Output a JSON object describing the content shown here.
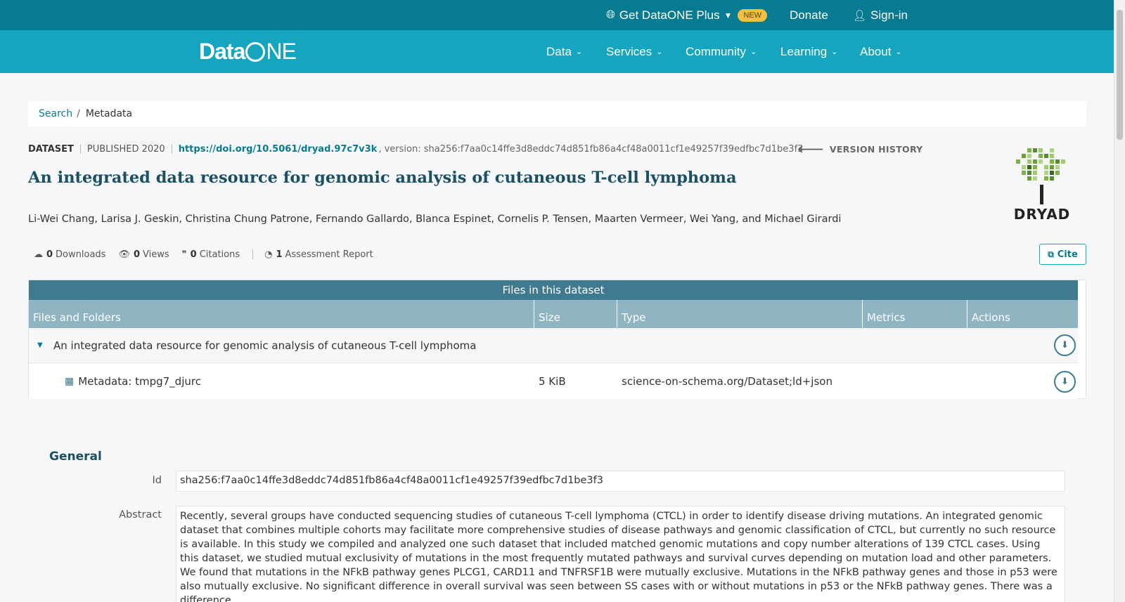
{
  "utility": {
    "plus_label": "Get DataONE Plus",
    "new_badge": "NEW",
    "donate_label": "Donate",
    "signin_label": "Sign-in"
  },
  "nav": {
    "logo_data": "Data",
    "logo_ne": "NE",
    "items": [
      {
        "label": "Data"
      },
      {
        "label": "Services"
      },
      {
        "label": "Community"
      },
      {
        "label": "Learning"
      },
      {
        "label": "About"
      }
    ]
  },
  "breadcrumb": {
    "search": "Search",
    "separator": "/",
    "current": "Metadata"
  },
  "dataset": {
    "type_label": "DATASET",
    "published": "PUBLISHED 2020",
    "doi": "https://doi.org/10.5061/dryad.97c7v3k",
    "version": ", version: sha256:f7aa0c14ffe3d8eddc74d851fb86a4cf48a0011cf1e49257f39edfbc7d1be3f3",
    "version_history": "VERSION HISTORY",
    "title": "An integrated data resource for genomic analysis of cutaneous T-cell lymphoma",
    "authors": "Li-Wei Chang, Larisa J. Geskin, Christina Chung Patrone, Fernando Gallardo, Blanca Espinet, Cornelis P. Tensen, Maarten Vermeer, Wei Yang, and Michael Girardi",
    "repository_logo": "DRYAD"
  },
  "stats": {
    "downloads_count": "0",
    "downloads_label": "Downloads",
    "views_count": "0",
    "views_label": "Views",
    "citations_count": "0",
    "citations_label": "Citations",
    "assessment_count": "1",
    "assessment_label": "Assessment Report",
    "cite_label": "Cite"
  },
  "files": {
    "title": "Files in this dataset",
    "columns": [
      "Files and Folders",
      "Size",
      "Type",
      "Metrics",
      "Actions"
    ],
    "folder": "An integrated data resource for genomic analysis of cutaneous T-cell lymphoma",
    "rows": [
      {
        "name": "Metadata: tmpg7_djurc",
        "size": "5 KiB",
        "type": "science-on-schema.org/Dataset;ld+json"
      }
    ]
  },
  "general": {
    "heading": "General",
    "id_label": "Id",
    "id_value": "sha256:f7aa0c14ffe3d8eddc74d851fb86a4cf48a0011cf1e49257f39edfbc7d1be3f3",
    "abstract_label": "Abstract",
    "abstract_value": "Recently, several groups have conducted sequencing studies of cutaneous T-cell lymphoma (CTCL) in order to identify disease driving mutations. An integrated genomic dataset that combines multiple cohorts may facilitate more comprehensive studies of disease pathways and genomic classification of CTCL, but currently no such resource is available. In this study we compiled and analyzed one such dataset that included matched genomic mutations and copy number alterations of 139 CTCL cases. Using this dataset, we studied mutual exclusivity of mutations in the most frequently mutated pathways and survival curves depending on mutation load and other parameters. We found that mutations in the NFkB pathway genes PLCG1, CARD11 and TNFRSF1B were mutually exclusive. Mutations in the NFkB pathway genes and those in p53 were also mutually exclusive. No significant difference in overall survival was seen between SS cases with or without mutations in p53 or the NFkB pathway genes. There was a difference"
  },
  "colors": {
    "topbar": "#077b92",
    "nav": "#16a5bf",
    "accent": "#077b92",
    "table_title": "#3f7a90",
    "table_head": "#8fb5c3",
    "badge": "#f0c040"
  }
}
